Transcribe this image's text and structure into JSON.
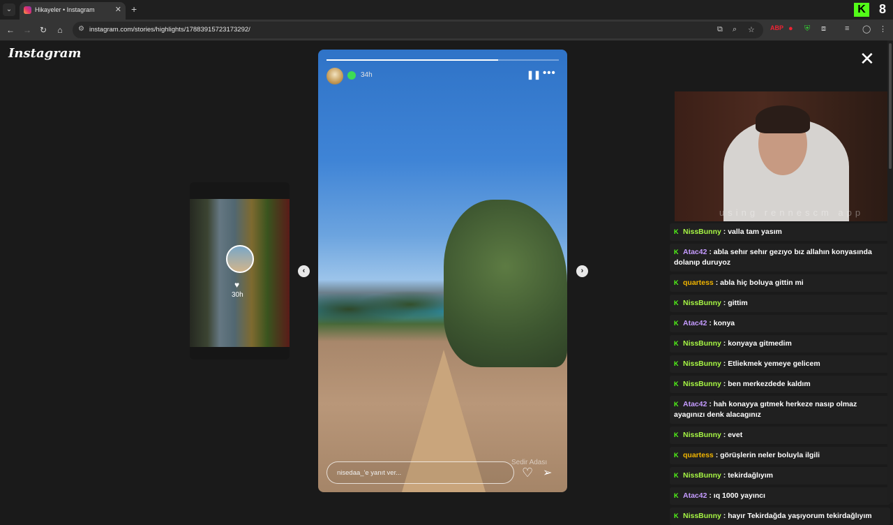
{
  "browser": {
    "tab_title": "Hikayeler • Instagram",
    "url": "instagram.com/stories/highlights/17883915723173292/",
    "extension_number": "8"
  },
  "instagram": {
    "logo": "Instagram",
    "previous_story_time": "30h",
    "story_time": "34h",
    "story_progress": 0.74,
    "location_label": "Sedir Adası",
    "reply_placeholder": "nisedaa_'e yanıt ver..."
  },
  "webcam": {
    "overlay_text": "using rennescm app"
  },
  "chat": {
    "messages": [
      {
        "user": "NissBunny",
        "text": "valla tam yasım",
        "color": "#a6f544"
      },
      {
        "user": "Atac42",
        "text": "abla sehır sehır gezıyo bız allahın konyasında dolanıp duruyoz",
        "color": "#c59bff"
      },
      {
        "user": "quartess",
        "text": "abla hiç boluya gittin mi",
        "color": "#f0b400"
      },
      {
        "user": "NissBunny",
        "text": "gittim",
        "color": "#a6f544"
      },
      {
        "user": "Atac42",
        "text": "konya",
        "color": "#c59bff"
      },
      {
        "user": "NissBunny",
        "text": "konyaya gitmedim",
        "color": "#a6f544"
      },
      {
        "user": "NissBunny",
        "text": "Etliekmek yemeye gelicem",
        "color": "#a6f544"
      },
      {
        "user": "NissBunny",
        "text": "ben merkezdede kaldım",
        "color": "#a6f544"
      },
      {
        "user": "Atac42",
        "text": "hah konayya gıtmek herkeze nasıp olmaz ayagınızı denk alacagınız",
        "color": "#c59bff"
      },
      {
        "user": "NissBunny",
        "text": "evet",
        "color": "#a6f544"
      },
      {
        "user": "quartess",
        "text": "görüşlerin neler boluyla ilgili",
        "color": "#f0b400"
      },
      {
        "user": "NissBunny",
        "text": "tekirdağlıyım",
        "color": "#a6f544"
      },
      {
        "user": "Atac42",
        "text": "ıq 1000 yayıncı",
        "color": "#c59bff"
      },
      {
        "user": "NissBunny",
        "text": "hayır Tekirdağda yaşıyorum tekirdağlıyım",
        "color": "#a6f544"
      }
    ]
  }
}
